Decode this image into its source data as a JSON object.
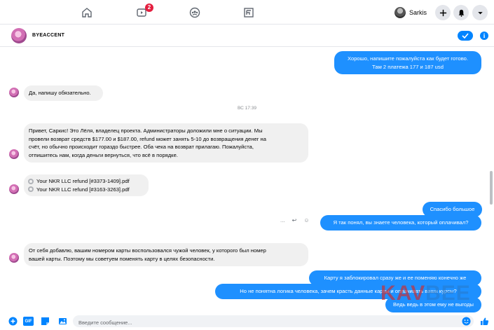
{
  "nav": {
    "video_badge": "2",
    "profile_name": "Sarkis"
  },
  "chat": {
    "contact_name": "BYEACCENT",
    "timestamp": "ВС 17:39",
    "messages": [
      {
        "id": "m1",
        "dir": "out",
        "lines": [
          "Хорошо, напишите пожалуйста как будет готово.",
          "Там 2 платежа 177 и 187 usd"
        ]
      },
      {
        "id": "m2",
        "dir": "in",
        "lines": [
          "Да, напишу обязательно."
        ]
      },
      {
        "id": "m3",
        "dir": "in",
        "lines": [
          "Привет, Саркис! Это Лёля, владелец проекта. Администраторы доложили мне о ситуации. Мы",
          "провели возврат средств $177.00 и $187.00, refund может занять 5-10 до возвращения денег на",
          "счёт, но обычно происходит гораздо быстрее. Оба чека на возврат прилагаю. Пожалуйста,",
          "отпишитесь нам, когда деньги вернуться, что всё в порядке."
        ]
      },
      {
        "id": "m4",
        "dir": "in",
        "files": [
          "Your NKR LLC refund [#3373-1409].pdf",
          "Your NKR LLC refund [#3163-3263].pdf"
        ]
      },
      {
        "id": "m5",
        "dir": "out",
        "lines": [
          "Спасибо большое"
        ]
      },
      {
        "id": "m6",
        "dir": "out",
        "lines": [
          "Я так понял, вы знаете человека, который оплачивал?"
        ]
      },
      {
        "id": "m7",
        "dir": "in",
        "lines": [
          "От себя добавлю, вашим номером карты воспользовался чужой человек, у которого был номер",
          "вашей карты. Поэтому мы советуем поменять карту в целях безопасности."
        ]
      },
      {
        "id": "m8",
        "dir": "out",
        "lines": [
          "Карту я заблокировал сразу же и ее поменяю конечно же"
        ]
      },
      {
        "id": "m9",
        "dir": "out",
        "lines": [
          "Но не понятна логика человека, зачем красть данные карты и оплачивать ваши курсы?"
        ]
      },
      {
        "id": "m10",
        "dir": "out",
        "lines": [
          "Ведь ведь в этом ему не выгоды"
        ]
      }
    ],
    "message_actions": [
      "...",
      "↩",
      "☺"
    ]
  },
  "composer": {
    "placeholder": "Введите сообщение...",
    "gif_label": "GIF"
  },
  "watermark": {
    "big_left": "KAV",
    "big_right": "BEE"
  },
  "colors": {
    "accent": "#0084ff",
    "outgoing": "#1e90ff",
    "incoming": "#f0f0f0",
    "badge": "#e41e3f"
  }
}
